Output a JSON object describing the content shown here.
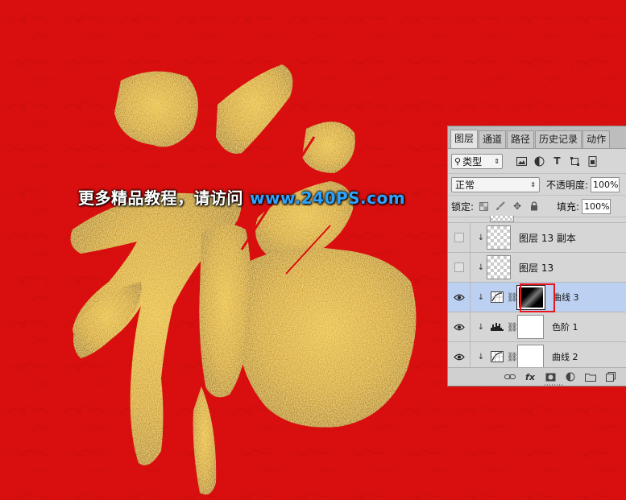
{
  "watermark": {
    "text_cn": "更多精品教程，请访问",
    "url": "www.240PS.com"
  },
  "colors": {
    "background_red": "#d90f0f",
    "gold": "#d4a21c",
    "selection_blue": "#bcd1f2",
    "highlight_box": "#e8161b"
  },
  "panel": {
    "tabs": [
      "图层",
      "通道",
      "路径",
      "历史记录",
      "动作"
    ],
    "filter": {
      "label": "类型"
    },
    "filter_icons": [
      "image-icon",
      "adjustment-icon",
      "type-icon",
      "shape-icon",
      "smart-object-icon"
    ],
    "blend_mode": "正常",
    "opacity_label": "不透明度:",
    "opacity_value": "100%",
    "lock_label": "锁定:",
    "fill_label": "填充:",
    "fill_value": "100%",
    "layers": [
      {
        "name": "图层 13 副本",
        "visible": false,
        "type": "pixel",
        "selected": false
      },
      {
        "name": "图层 13",
        "visible": false,
        "type": "pixel",
        "selected": false
      },
      {
        "name": "曲线 3",
        "visible": true,
        "type": "curves",
        "selected": true
      },
      {
        "name": "色阶 1",
        "visible": true,
        "type": "levels",
        "selected": false
      },
      {
        "name": "曲线 2",
        "visible": true,
        "type": "curves",
        "selected": false
      }
    ],
    "bottom_icons": [
      "link-icon",
      "fx-icon",
      "mask-icon",
      "adjustment-icon",
      "folder-icon",
      "new-layer-icon"
    ],
    "fx_label": "fx"
  }
}
